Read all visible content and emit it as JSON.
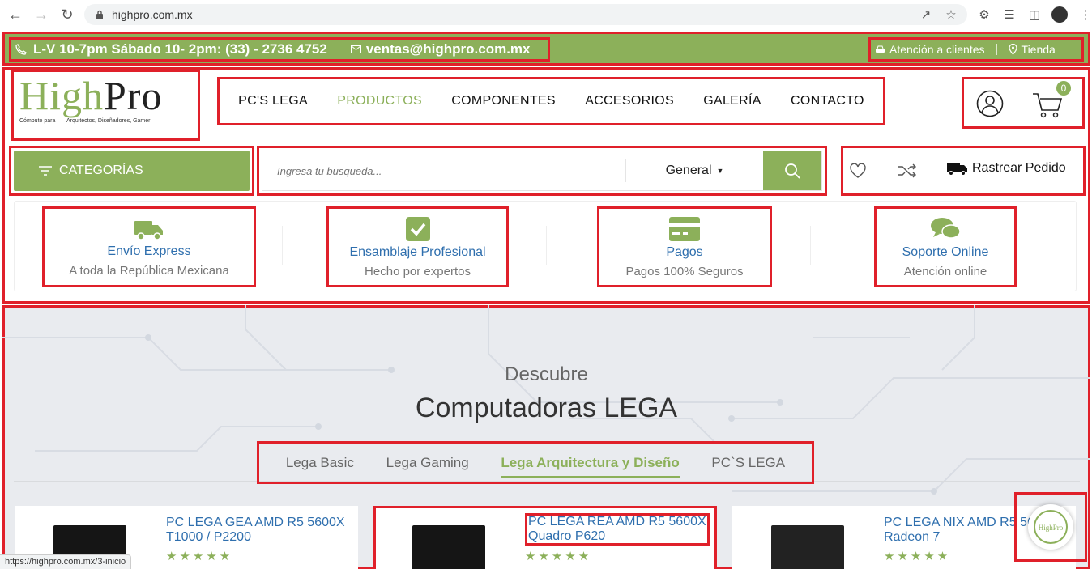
{
  "browser": {
    "url": "highpro.com.mx",
    "status_url": "https://highpro.com.mx/3-inicio"
  },
  "topbar": {
    "hours_phone": "L-V 10-7pm Sábado 10- 2pm: (33) - 2736 4752",
    "email": "ventas@highpro.com.mx",
    "customer_service": "Atención a clientes",
    "store": "Tienda"
  },
  "logo": {
    "high": "High",
    "pro": "Pro",
    "tagline_left": "Cómputo para",
    "tagline_right": "Arquitectos, Diseñadores, Gamer"
  },
  "nav": {
    "items": [
      "PC'S LEGA",
      "PRODUCTOS",
      "COMPONENTES",
      "ACCESORIOS",
      "GALERÍA",
      "CONTACTO"
    ],
    "active": "PRODUCTOS"
  },
  "cart": {
    "count": "0"
  },
  "categories": {
    "label": "CATEGORÍAS"
  },
  "search": {
    "placeholder": "Ingresa tu busqueda...",
    "scope": "General"
  },
  "tools": {
    "track_label": "Rastrear Pedido"
  },
  "features": [
    {
      "title": "Envío Express",
      "subtitle": "A toda la República Mexicana",
      "icon": "truck-icon"
    },
    {
      "title": "Ensamblaje Profesional",
      "subtitle": "Hecho por expertos",
      "icon": "check-icon"
    },
    {
      "title": "Pagos",
      "subtitle": "Pagos 100% Seguros",
      "icon": "credit-card-icon"
    },
    {
      "title": "Soporte Online",
      "subtitle": "Atención online",
      "icon": "chat-icon"
    }
  ],
  "hero": {
    "kicker": "Descubre",
    "title": "Computadoras LEGA",
    "tabs": [
      "Lega Basic",
      "Lega Gaming",
      "Lega Arquitectura y Diseño",
      "PC`S LEGA"
    ],
    "active_tab": "Lega Arquitectura y Diseño"
  },
  "products": [
    {
      "name_line1": "PC LEGA GEA AMD R5 5600X",
      "name_line2": "T1000 / P2200",
      "rating": 5
    },
    {
      "name_line1": "PC LEGA REA AMD R5 5600X",
      "name_line2": "Quadro P620",
      "rating": 5
    },
    {
      "name_line1": "PC LEGA NIX AMD R5 56",
      "name_line2": "Radeon 7",
      "rating": 5
    }
  ],
  "colors": {
    "brand_green": "#8cb05a",
    "link_blue": "#2f6fae",
    "highlight_red": "#e0202a"
  }
}
